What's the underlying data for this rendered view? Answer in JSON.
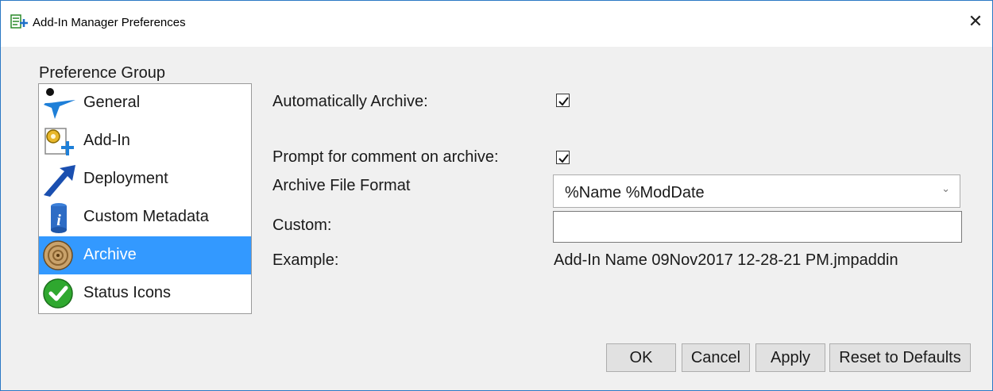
{
  "window": {
    "title": "Add-In Manager Preferences",
    "close_glyph": "✕",
    "title_icon": "addin-manager-icon"
  },
  "preference_group": {
    "label": "Preference Group",
    "selected_index": 4,
    "items": [
      {
        "label": "General",
        "icon": "general-star-icon"
      },
      {
        "label": "Add-In",
        "icon": "addin-gear-icon"
      },
      {
        "label": "Deployment",
        "icon": "deployment-arrow-icon"
      },
      {
        "label": "Custom Metadata",
        "icon": "info-icon"
      },
      {
        "label": "Archive",
        "icon": "archive-roll-icon"
      },
      {
        "label": "Status Icons",
        "icon": "green-check-icon"
      }
    ]
  },
  "settings": {
    "auto_archive_label": "Automatically Archive:",
    "auto_archive_checked": true,
    "prompt_comment_label": "Prompt for comment on archive:",
    "prompt_comment_checked": true,
    "file_format_label": "Archive File Format",
    "file_format_value": "%Name %ModDate",
    "custom_label": "Custom:",
    "custom_value": "",
    "example_label": "Example:",
    "example_value": "Add-In Name 09Nov2017 12-28-21 PM.jmpaddin"
  },
  "buttons": {
    "ok": "OK",
    "cancel": "Cancel",
    "apply": "Apply",
    "reset": "Reset to Defaults"
  },
  "colors": {
    "selection": "#3399ff",
    "window_border": "#2b78c4",
    "dialog_bg": "#f0f0f0"
  }
}
